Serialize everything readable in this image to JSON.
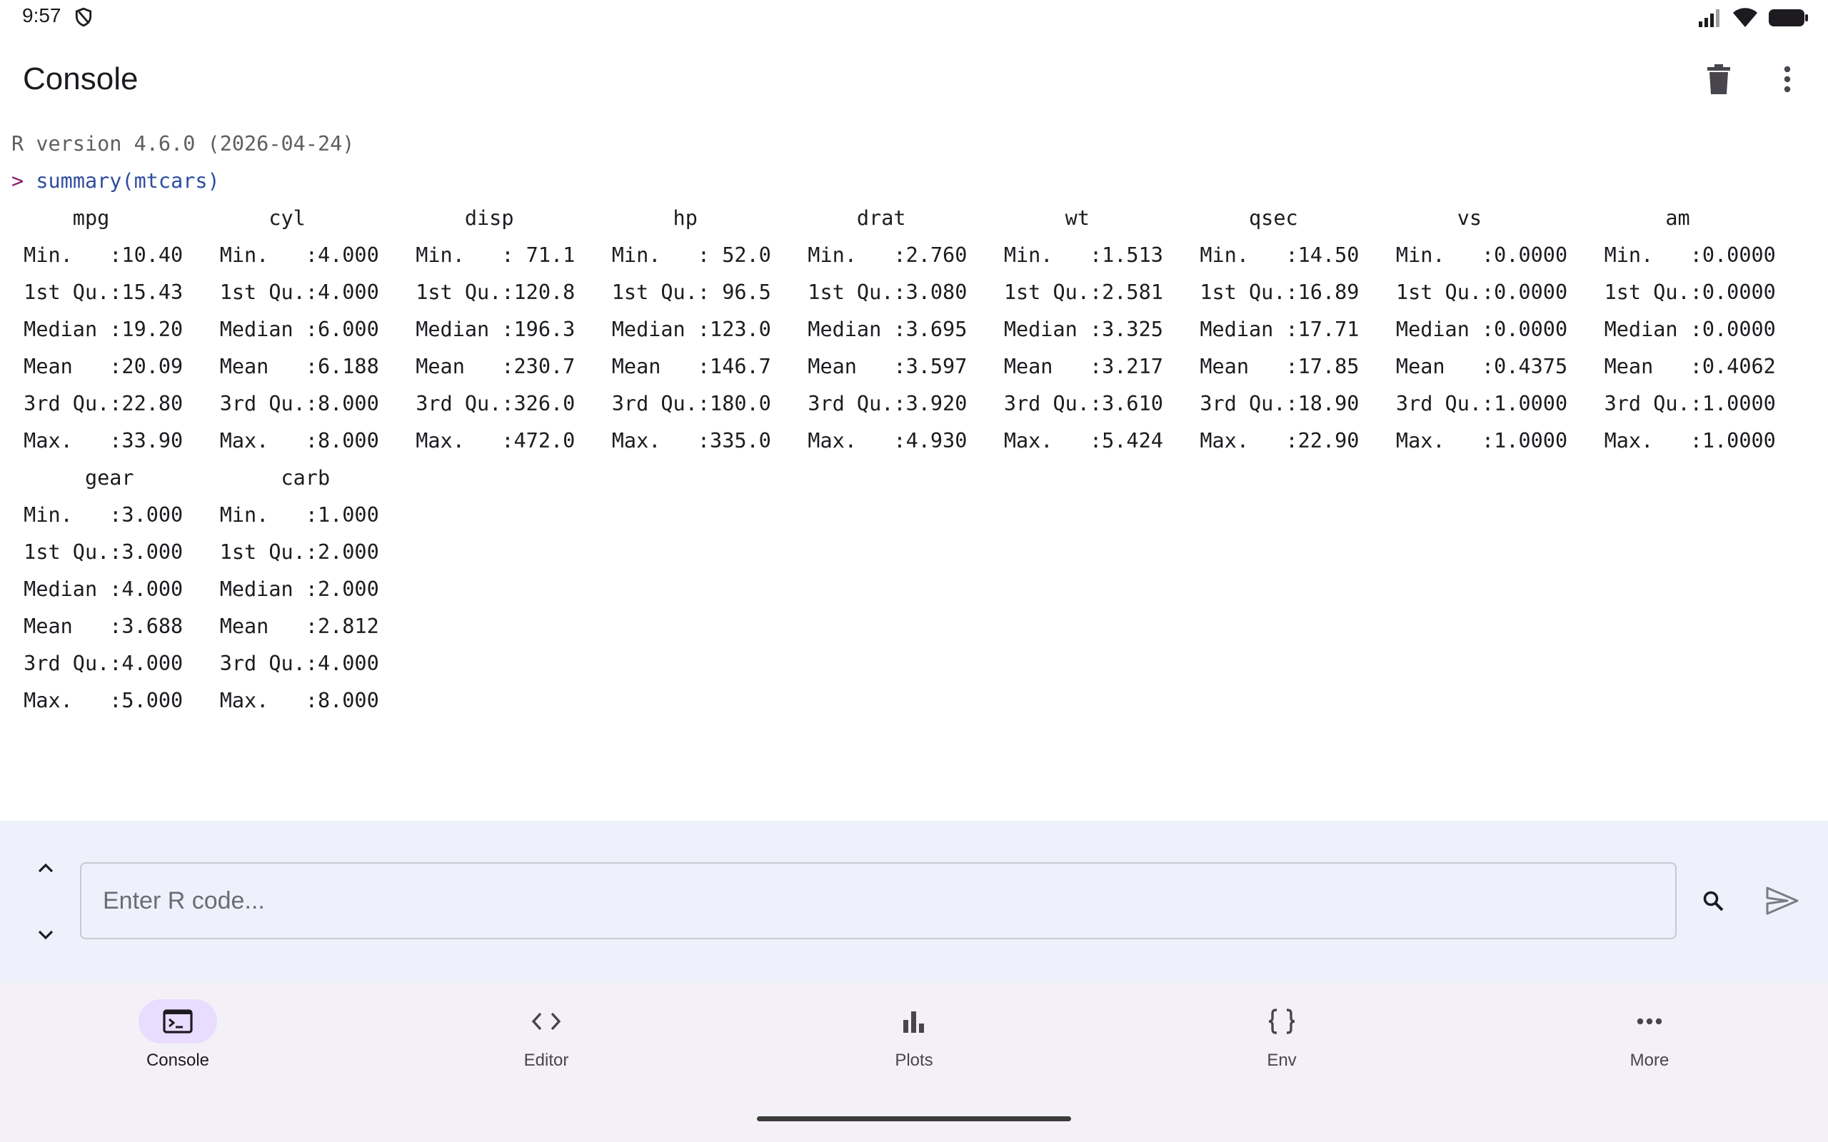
{
  "status_bar": {
    "time": "9:57"
  },
  "app_bar": {
    "title": "Console"
  },
  "console": {
    "version_line": "R version 4.6.0 (2026-04-24)",
    "prompt": ">",
    "command": "summary(mtcars)",
    "output_lines": [
      "     mpg             cyl             disp             hp             drat             wt             qsec             vs               am          ",
      " Min.   :10.40   Min.   :4.000   Min.   : 71.1   Min.   : 52.0   Min.   :2.760   Min.   :1.513   Min.   :14.50   Min.   :0.0000   Min.   :0.0000  ",
      " 1st Qu.:15.43   1st Qu.:4.000   1st Qu.:120.8   1st Qu.: 96.5   1st Qu.:3.080   1st Qu.:2.581   1st Qu.:16.89   1st Qu.:0.0000   1st Qu.:0.0000  ",
      " Median :19.20   Median :6.000   Median :196.3   Median :123.0   Median :3.695   Median :3.325   Median :17.71   Median :0.0000   Median :0.0000  ",
      " Mean   :20.09   Mean   :6.188   Mean   :230.7   Mean   :146.7   Mean   :3.597   Mean   :3.217   Mean   :17.85   Mean   :0.4375   Mean   :0.4062  ",
      " 3rd Qu.:22.80   3rd Qu.:8.000   3rd Qu.:326.0   3rd Qu.:180.0   3rd Qu.:3.920   3rd Qu.:3.610   3rd Qu.:18.90   3rd Qu.:1.0000   3rd Qu.:1.0000  ",
      " Max.   :33.90   Max.   :8.000   Max.   :472.0   Max.   :335.0   Max.   :4.930   Max.   :5.424   Max.   :22.90   Max.   :1.0000   Max.   :1.0000  ",
      "      gear            carb      ",
      " Min.   :3.000   Min.   :1.000  ",
      " 1st Qu.:3.000   1st Qu.:2.000  ",
      " Median :4.000   Median :2.000  ",
      " Mean   :3.688   Mean   :2.812  ",
      " 3rd Qu.:4.000   3rd Qu.:4.000  ",
      " Max.   :5.000   Max.   :8.000  "
    ]
  },
  "input": {
    "placeholder": "Enter R code...",
    "value": ""
  },
  "nav": {
    "items": [
      {
        "label": "Console",
        "icon": "terminal-icon",
        "active": true
      },
      {
        "label": "Editor",
        "icon": "code-icon",
        "active": false
      },
      {
        "label": "Plots",
        "icon": "bar-chart-icon",
        "active": false
      },
      {
        "label": "Env",
        "icon": "braces-icon",
        "active": false
      },
      {
        "label": "More",
        "icon": "more-horizontal-icon",
        "active": false
      }
    ]
  },
  "colors": {
    "accent_pill": "#e9ddff",
    "input_bg": "#eef1fb",
    "nav_bg": "#f3f1f7",
    "command": "#2f4ea0",
    "prompt": "#8a1c6b"
  }
}
